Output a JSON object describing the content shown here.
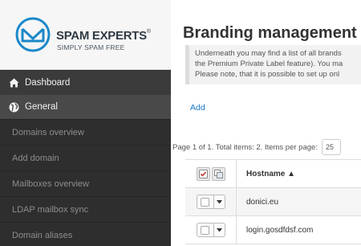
{
  "brand": {
    "name": "SPAM EXPERTS",
    "registered": "®",
    "tagline": "SIMPLY SPAM FREE"
  },
  "sidebar": {
    "dashboard": {
      "label": "Dashboard",
      "icon": "home-icon"
    },
    "general": {
      "label": "General",
      "icon": "globe-icon"
    },
    "items": [
      {
        "label": "Domains overview"
      },
      {
        "label": "Add domain"
      },
      {
        "label": "Mailboxes overview"
      },
      {
        "label": "LDAP mailbox sync"
      },
      {
        "label": "Domain aliases"
      }
    ]
  },
  "main": {
    "title": "Branding management",
    "info_lines": [
      "Underneath you may find a list of all brands",
      "the Premium Private Label feature). You ma",
      "Please note, that it is possible to set up onl"
    ],
    "add_label": "Add",
    "pager_text": "Page 1 of 1. Total items: 2. Items per page:",
    "per_page_value": "25"
  },
  "table": {
    "header": {
      "hostname": "Hostname ▲"
    },
    "rows": [
      {
        "hostname": "donici.eu"
      },
      {
        "hostname": "login.gosdfdsf.com"
      }
    ]
  },
  "colors": {
    "sidebar_bg": "#2e2e2e",
    "active_bg": "#494949",
    "link": "#1a76c8",
    "logo_blue": "#1a88c9"
  }
}
